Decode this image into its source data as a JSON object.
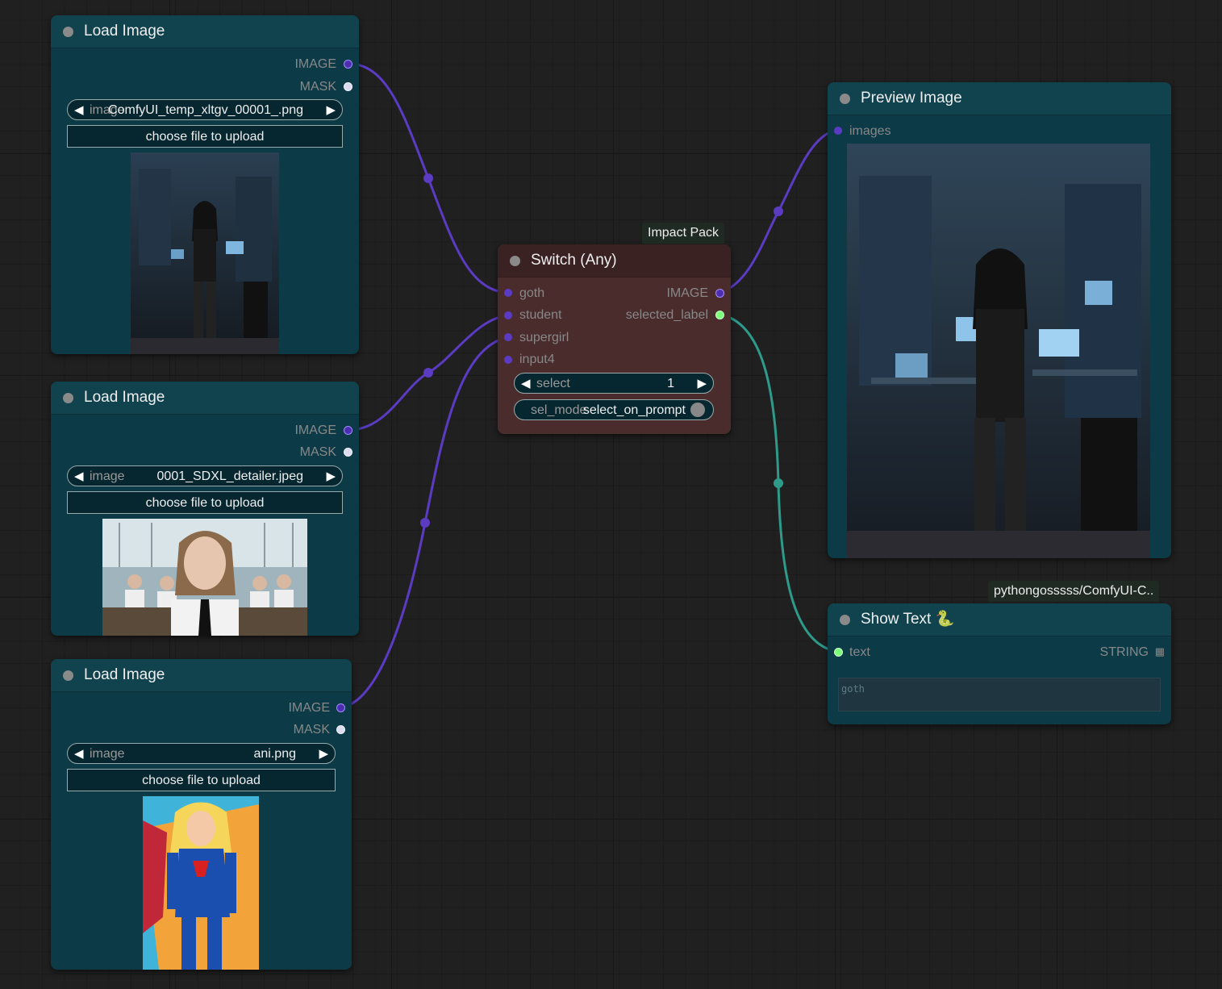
{
  "nodes": {
    "load_image_1": {
      "title": "Load Image",
      "outputs": [
        "IMAGE",
        "MASK"
      ],
      "combo_label": "image",
      "combo_value": "ComfyUI_temp_xltgv_00001_.png",
      "upload_label": "choose file to upload",
      "preview_icon": "goth-girl-server-room-image"
    },
    "load_image_2": {
      "title": "Load Image",
      "outputs": [
        "IMAGE",
        "MASK"
      ],
      "combo_label": "image",
      "combo_value": "0001_SDXL_detailer.jpeg",
      "upload_label": "choose file to upload",
      "preview_icon": "student-classroom-image"
    },
    "load_image_3": {
      "title": "Load Image",
      "outputs": [
        "IMAGE",
        "MASK"
      ],
      "combo_label": "image",
      "combo_value": "ani.png",
      "upload_label": "choose file to upload",
      "preview_icon": "supergirl-illustration-image"
    },
    "switch": {
      "badge": "Impact Pack",
      "title": "Switch (Any)",
      "inputs": [
        "goth",
        "student",
        "supergirl",
        "input4"
      ],
      "outputs": [
        "IMAGE",
        "selected_label"
      ],
      "select_label": "select",
      "select_value": "1",
      "sel_mode_label": "sel_mode",
      "sel_mode_value": "select_on_prompt"
    },
    "preview": {
      "title": "Preview Image",
      "input": "images",
      "preview_icon": "goth-girl-server-room-image"
    },
    "show_text": {
      "badge": "pythongosssss/ComfyUI-C..",
      "title": "Show Text 🐍",
      "input": "text",
      "output": "STRING",
      "content": "goth"
    }
  },
  "colors": {
    "image_link": "#5a3bc2",
    "string_link": "#2e9a8a",
    "node_bg": "#0c3a47",
    "switch_bg": "#4a2c2c"
  }
}
